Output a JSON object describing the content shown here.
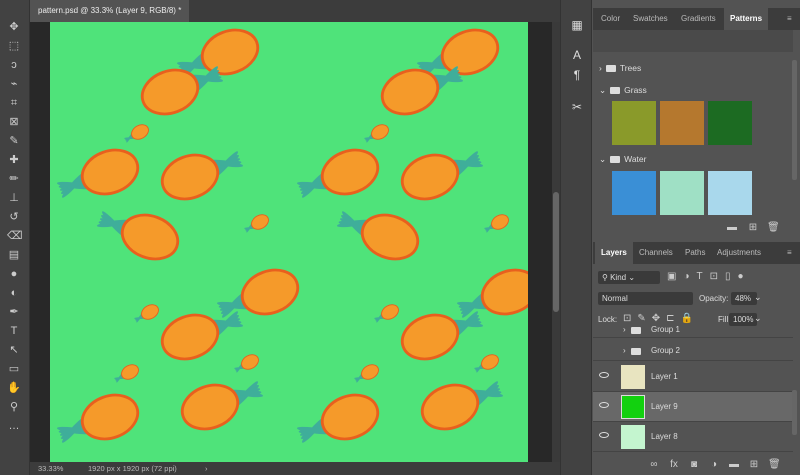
{
  "document": {
    "tab_title": "pattern.psd @ 33.3% (Layer 9, RGB/8) *",
    "zoom": "33.33%",
    "dimensions": "1920 px x 1920 px (72 ppi)",
    "canvas_color": "#4fe37a"
  },
  "toolbar": {
    "tools": [
      "move-icon",
      "marquee-icon",
      "lasso-icon",
      "quick-select-icon",
      "crop-icon",
      "frame-icon",
      "eyedropper-icon",
      "healing-icon",
      "brush-icon",
      "stamp-icon",
      "history-brush-icon",
      "eraser-icon",
      "gradient-icon",
      "blur-icon",
      "dodge-icon",
      "pen-icon",
      "type-icon",
      "path-select-icon",
      "shape-icon",
      "hand-icon",
      "zoom-icon",
      "more-icon"
    ]
  },
  "iconstrip": {
    "icons": [
      "history-icon",
      "character-icon",
      "paragraph-icon",
      "tools-icon"
    ]
  },
  "patterns_panel": {
    "tabs": [
      "Color",
      "Swatches",
      "Gradients",
      "Patterns"
    ],
    "active_tab": "Patterns",
    "groups": [
      {
        "name": "Trees",
        "expanded": false,
        "swatches": []
      },
      {
        "name": "Grass",
        "expanded": true,
        "swatches": [
          "#8a9a2a",
          "#b5782e",
          "#1c6b22"
        ]
      },
      {
        "name": "Water",
        "expanded": true,
        "swatches": [
          "#3a8fd6",
          "#9fe0c5",
          "#a9d8ec"
        ]
      }
    ]
  },
  "layers_panel": {
    "tabs": [
      "Layers",
      "Channels",
      "Paths",
      "Adjustments"
    ],
    "active_tab": "Layers",
    "filter": "Kind",
    "blend_mode": "Normal",
    "opacity_label": "Opacity:",
    "opacity": "48%",
    "lock_label": "Lock:",
    "fill_label": "Fill:",
    "fill": "100%",
    "layers": [
      {
        "name": "Group 1",
        "type": "group",
        "visible": false
      },
      {
        "name": "Group 2",
        "type": "group",
        "visible": false
      },
      {
        "name": "Layer 1",
        "type": "layer",
        "visible": true,
        "color": "#e8e4c0",
        "selected": false
      },
      {
        "name": "Layer 9",
        "type": "layer",
        "visible": true,
        "color": "#12d10f",
        "selected": true
      },
      {
        "name": "Layer 8",
        "type": "layer",
        "visible": true,
        "color": "#c4f5cf",
        "selected": false
      }
    ]
  }
}
